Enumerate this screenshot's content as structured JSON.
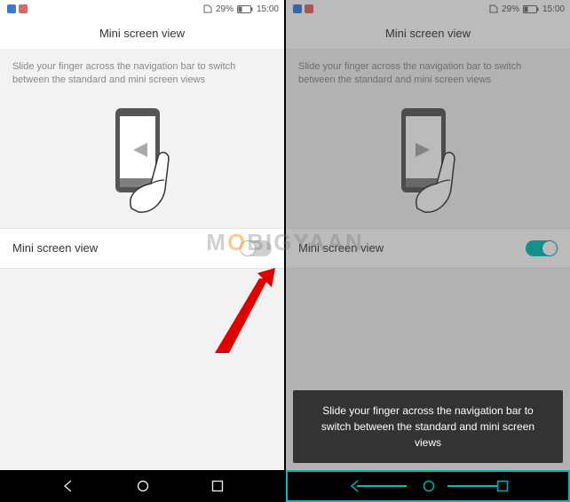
{
  "status": {
    "battery_pct": "29%",
    "time": "15:00"
  },
  "screen": {
    "title": "Mini screen view",
    "instruction": "Slide your finger across the navigation bar to switch between the standard and mini screen views",
    "toggle_label": "Mini screen view"
  },
  "left": {
    "toggle_on": false
  },
  "right": {
    "toggle_on": true,
    "popup_text": "Slide your finger across the navigation bar to switch between the standard and mini screen views"
  },
  "watermark": {
    "pre": "M",
    "accent": "O",
    "post": "BIGYAAN"
  }
}
